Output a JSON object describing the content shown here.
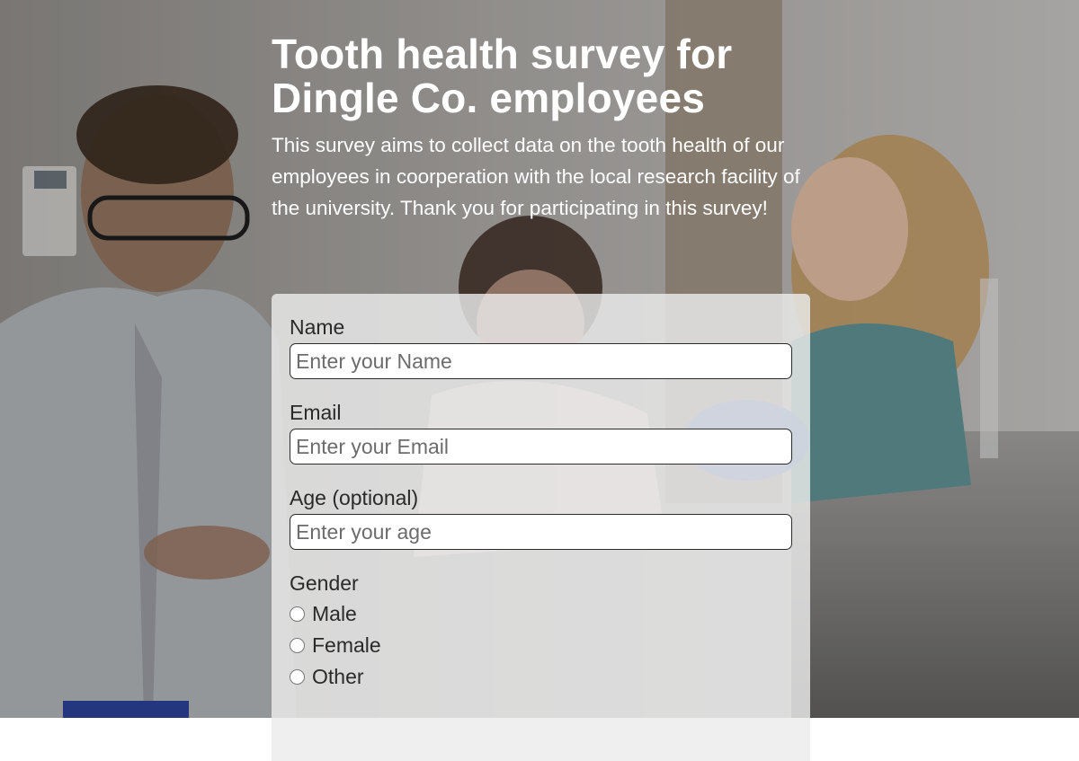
{
  "header": {
    "title_line1": "Tooth health survey for",
    "title_line2": "Dingle Co. employees",
    "description": "This survey aims to collect data on the tooth health of our employees in coorperation with the local research facility of the university. Thank you for participating in this survey!"
  },
  "form": {
    "name": {
      "label": "Name",
      "placeholder": "Enter your Name"
    },
    "email": {
      "label": "Email",
      "placeholder": "Enter your Email"
    },
    "age": {
      "label": "Age (optional)",
      "placeholder": "Enter your age"
    },
    "gender": {
      "label": "Gender",
      "options": [
        "Male",
        "Female",
        "Other"
      ]
    }
  },
  "colors": {
    "card_background": "#ececec",
    "text": "#2a2a2a",
    "title": "#ffffff"
  }
}
